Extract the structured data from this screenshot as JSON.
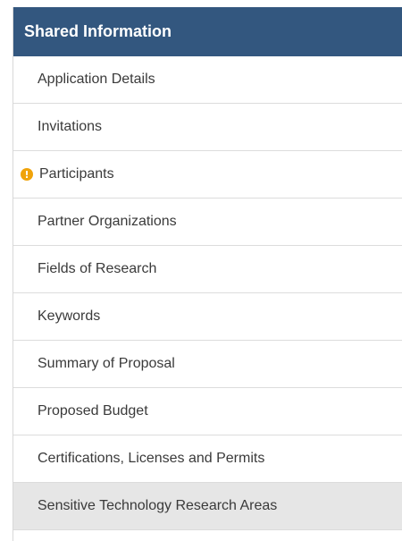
{
  "sidebar": {
    "title": "Shared Information",
    "header_color": "#33577f",
    "alert_color": "#f0a30a",
    "items": [
      {
        "label": "Application Details",
        "selected": false,
        "alert": false
      },
      {
        "label": "Invitations",
        "selected": false,
        "alert": false
      },
      {
        "label": "Participants",
        "selected": false,
        "alert": true,
        "alert_icon": "!",
        "icon_name": "warning-icon"
      },
      {
        "label": "Partner Organizations",
        "selected": false,
        "alert": false
      },
      {
        "label": "Fields of Research",
        "selected": false,
        "alert": false
      },
      {
        "label": "Keywords",
        "selected": false,
        "alert": false
      },
      {
        "label": "Summary of Proposal",
        "selected": false,
        "alert": false
      },
      {
        "label": "Proposed Budget",
        "selected": false,
        "alert": false
      },
      {
        "label": "Certifications, Licenses and Permits",
        "selected": false,
        "alert": false
      },
      {
        "label": "Sensitive Technology Research Areas",
        "selected": true,
        "alert": false
      }
    ]
  }
}
